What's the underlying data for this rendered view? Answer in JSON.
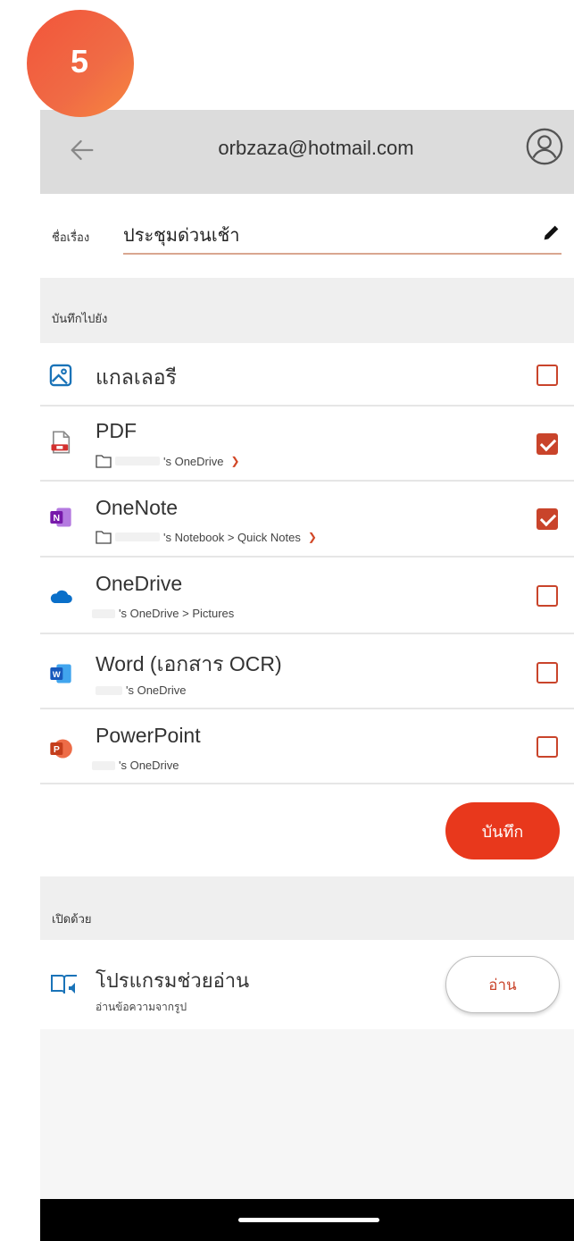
{
  "badge": {
    "number": "5",
    "color": "#f2553a"
  },
  "header": {
    "account_email": "orbzaza@hotmail.com",
    "back_icon": "arrow-left-icon",
    "account_icon": "account-circle-icon"
  },
  "title_field": {
    "label": "ชื่อเรื่อง",
    "value": "ประชุมด่วนเช้า",
    "edit_icon": "pencil-icon"
  },
  "save_to": {
    "header": "บันทึกไปยัง",
    "accent_color": "#c9442b",
    "items": [
      {
        "name": "แกลเลอรี",
        "sub": "",
        "checked": false,
        "icon": "gallery-icon"
      },
      {
        "name": "PDF",
        "sub": "'s OneDrive",
        "checked": true,
        "icon": "pdf-icon"
      },
      {
        "name": "OneNote",
        "sub": "'s Notebook > Quick Notes",
        "checked": true,
        "icon": "onenote-icon"
      },
      {
        "name": "OneDrive",
        "sub": "'s OneDrive > Pictures",
        "checked": false,
        "icon": "onedrive-icon"
      },
      {
        "name": "Word (เอกสาร OCR)",
        "sub": "'s OneDrive",
        "checked": false,
        "icon": "word-icon"
      },
      {
        "name": "PowerPoint",
        "sub": "'s OneDrive",
        "checked": false,
        "icon": "powerpoint-icon"
      }
    ]
  },
  "save_button": {
    "label": "บันทึก",
    "color": "#e8381c"
  },
  "open_with": {
    "header": "เปิดด้วย",
    "app_name": "โปรแกรมช่วยอ่าน",
    "app_sub": "อ่านข้อความจากรูป",
    "action_label": "อ่าน",
    "icon": "immersive-reader-icon"
  }
}
